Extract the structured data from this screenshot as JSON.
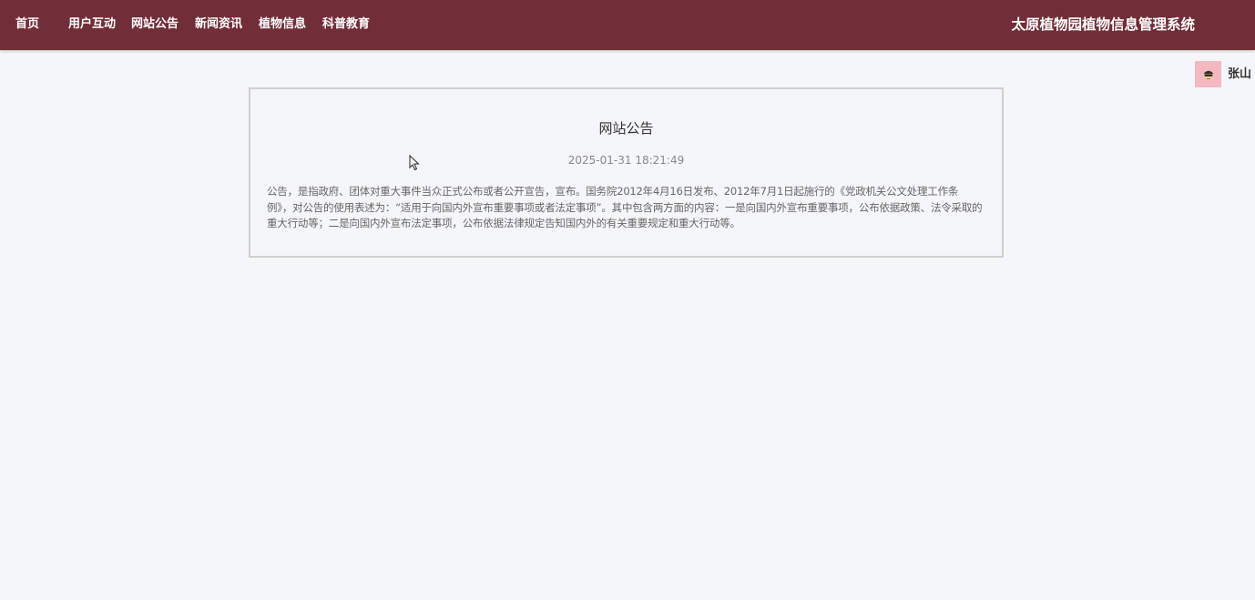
{
  "nav": {
    "items": [
      {
        "label": "首页"
      },
      {
        "label": "用户互动"
      },
      {
        "label": "网站公告"
      },
      {
        "label": "新闻资讯"
      },
      {
        "label": "植物信息"
      },
      {
        "label": "科普教育"
      }
    ],
    "site_title": "太原植物园植物信息管理系统"
  },
  "user": {
    "name": "张山",
    "avatar_icon": "user-avatar-icon"
  },
  "notice": {
    "title": "网站公告",
    "datetime": "2025-01-31 18:21:49",
    "content": "公告，是指政府、团体对重大事件当众正式公布或者公开宣告，宣布。国务院2012年4月16日发布、2012年7月1日起施行的《党政机关公文处理工作条例》，对公告的使用表述为：“适用于向国内外宣布重要事项或者法定事项”。其中包含两方面的内容：一是向国内外宣布重要事项，公布依据政策、法令采取的重大行动等；二是向国内外宣布法定事项，公布依据法律规定告知国内外的有关重要规定和重大行动等。"
  },
  "colors": {
    "header_bg": "#722e38",
    "page_bg": "#f5f6f8",
    "avatar_bg": "#f4b8c2"
  }
}
